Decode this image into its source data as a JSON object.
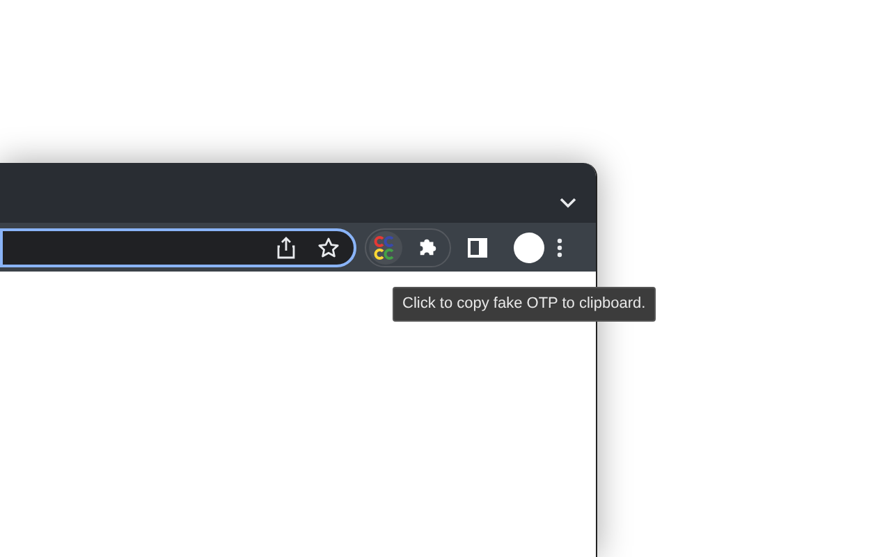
{
  "address_bar": {
    "focused": true
  },
  "tooltip": {
    "text": "Click to copy fake OTP to clipboard."
  }
}
